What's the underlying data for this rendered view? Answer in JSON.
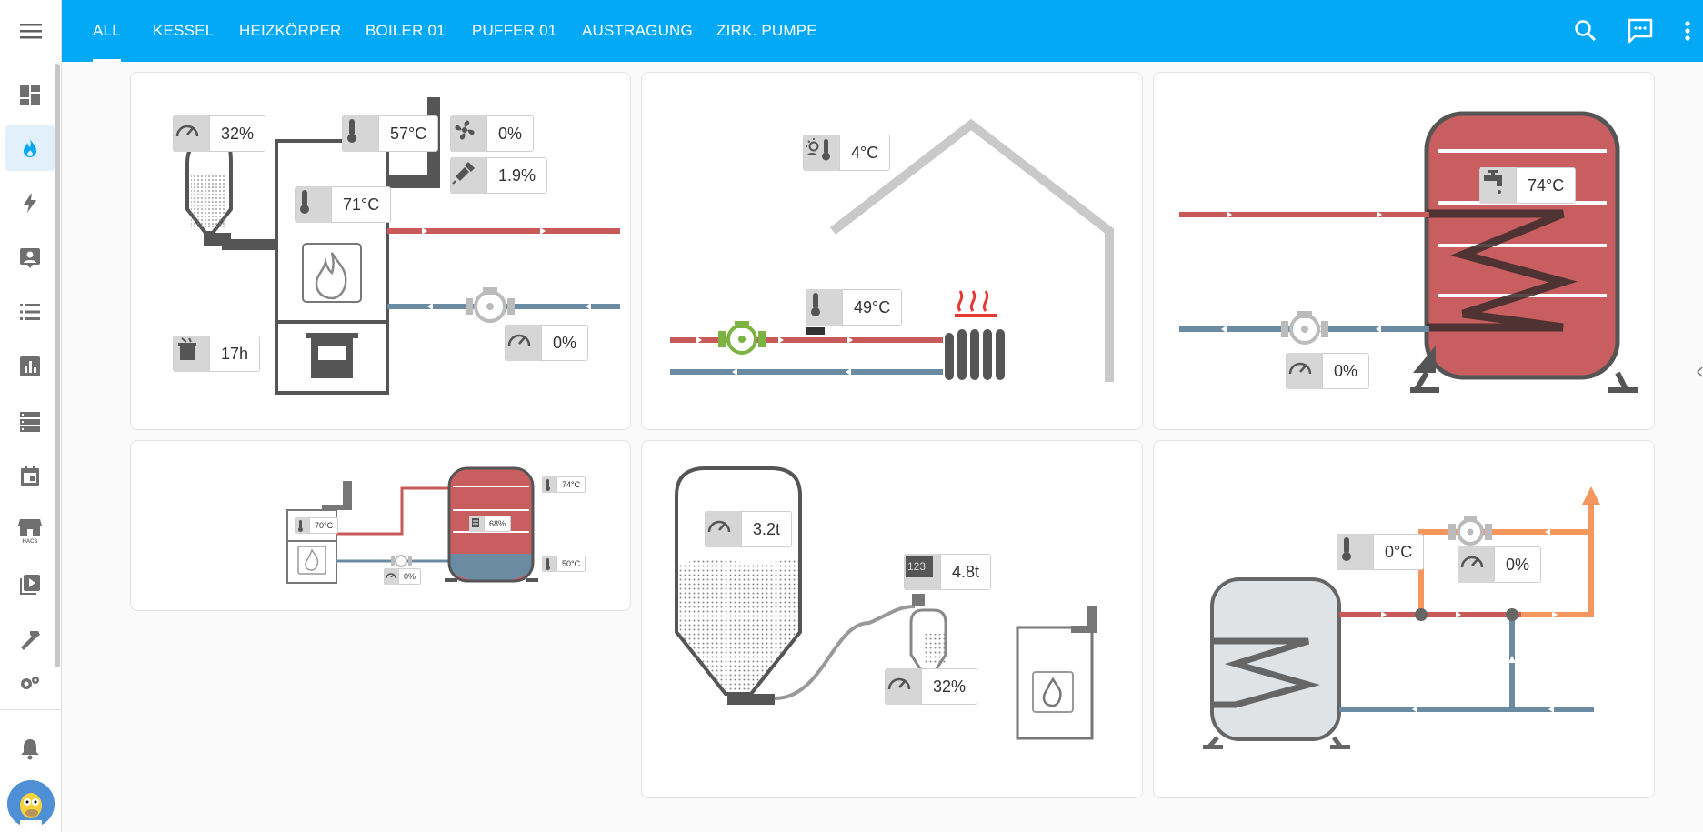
{
  "tabs": [
    "All",
    "Kessel",
    "Heizkörper",
    "Boiler 01",
    "Puffer 01",
    "Austragung",
    "Zirk. Pumpe"
  ],
  "sidebar": {
    "items": [
      {
        "icon": "dashboard-icon"
      },
      {
        "icon": "fire-icon",
        "active": true
      },
      {
        "icon": "lightning-icon"
      },
      {
        "icon": "account-box-icon"
      },
      {
        "icon": "list-icon"
      },
      {
        "icon": "chart-icon"
      },
      {
        "icon": "server-icon"
      },
      {
        "icon": "calendar-icon"
      },
      {
        "icon": "hacs-store-icon",
        "label": "HACS"
      },
      {
        "icon": "media-icon"
      },
      {
        "icon": "hammer-icon"
      },
      {
        "icon": "gears-icon"
      }
    ],
    "notifications_icon": "bell-icon",
    "avatar_icon": "user-avatar"
  },
  "colors": {
    "accent": "#03a9f4",
    "hot_pipe": "#c85a5a",
    "cold_pipe": "#6a8ba1",
    "orange_pipe": "#f4975e",
    "pump_green": "#7cb342",
    "tank_red": "#c95e60",
    "tank_grey": "#dfe3e6"
  },
  "kessel": {
    "feed_level": "32%",
    "flue_temp": "57°C",
    "fan": "0%",
    "ignition": "1.9%",
    "boiler_temp": "71°C",
    "runtime": "17h",
    "pump_output": "0%"
  },
  "heizkoerper": {
    "outdoor_temp": "4°C",
    "flow_temp": "49°C"
  },
  "boiler": {
    "water_temp": "74°C",
    "pump_output": "0%"
  },
  "puffer": {
    "top_temp": "74°C",
    "kessel_temp": "70°C",
    "charge": "68%",
    "bottom_temp": "50°C",
    "pump": "0%"
  },
  "austragung": {
    "silo_level": "3.2t",
    "counter": "4.8t",
    "hopper_level": "32%"
  },
  "zirk": {
    "temp": "0°C",
    "pump": "0%"
  }
}
